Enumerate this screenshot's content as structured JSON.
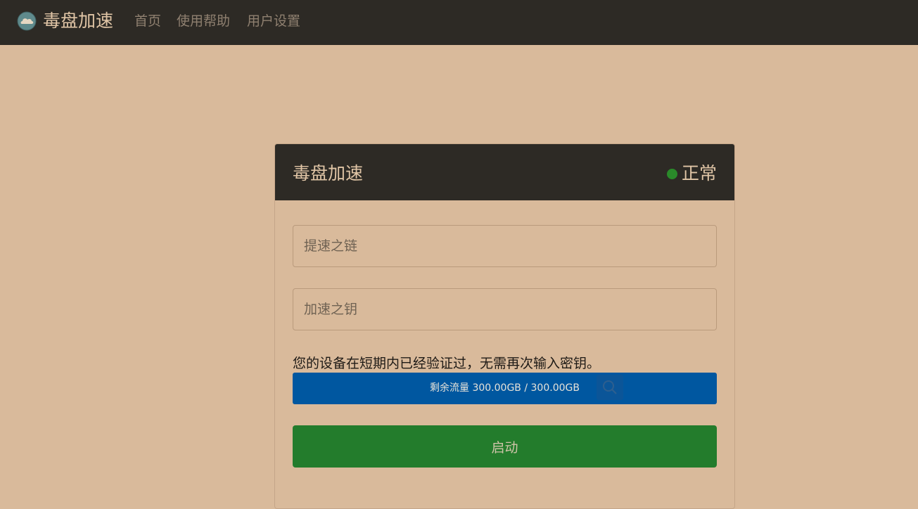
{
  "navbar": {
    "brand": "毒盘加速",
    "links": [
      "首页",
      "使用帮助",
      "用户设置"
    ]
  },
  "card": {
    "title": "毒盘加速",
    "status": "正常",
    "status_color": "#2a8a2a",
    "link_input": {
      "placeholder": "提速之链",
      "value": ""
    },
    "key_input": {
      "placeholder": "加速之钥",
      "value": ""
    },
    "notice": "您的设备在短期内已经验证过，无需再次输入密钥。",
    "traffic": "剩余流量 300.00GB / 300.00GB",
    "start_label": "启动"
  },
  "colors": {
    "page_bg": "#d9ba9b",
    "header_bg": "#2d2a25",
    "traffic_bar": "#0057a0",
    "start_button": "#237c2c"
  },
  "icons": {
    "brand": "cloud-logo-icon",
    "traffic": "search-icon"
  }
}
